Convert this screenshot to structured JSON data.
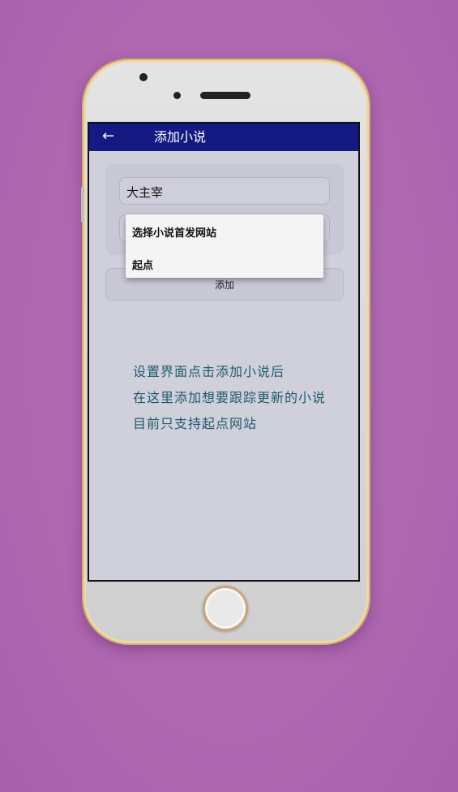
{
  "appbar": {
    "title": "添加小说"
  },
  "form": {
    "novel_name_value": "大主宰",
    "add_button_label": "添加"
  },
  "dropdown": {
    "header": "选择小说首发网站",
    "options": [
      "起点"
    ]
  },
  "help": {
    "lines": [
      "设置界面点击添加小说后",
      "在这里添加想要跟踪更新的小说",
      "目前只支持起点网站"
    ]
  },
  "colors": {
    "background": "#b06ab2",
    "appbar": "#141a82",
    "help_text": "#1f5a6a"
  },
  "icons": {
    "back": "back-arrow-icon"
  }
}
